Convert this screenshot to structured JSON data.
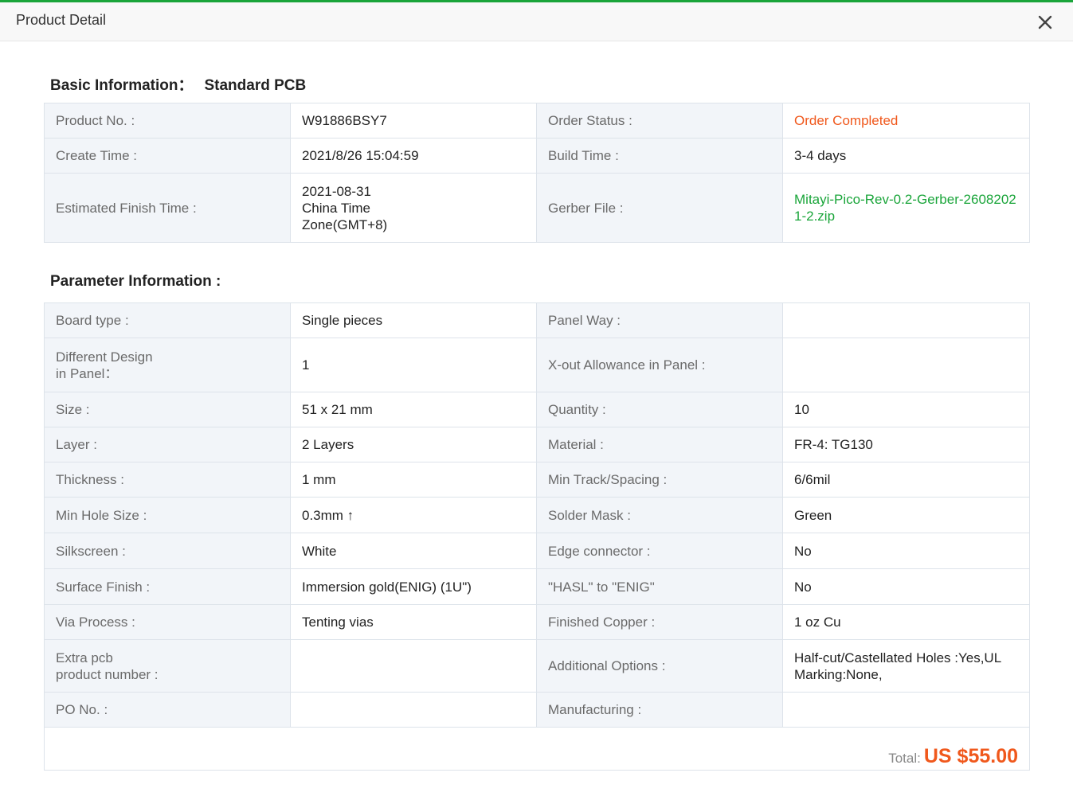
{
  "window": {
    "title": "Product Detail"
  },
  "basic": {
    "heading": "Basic Information：",
    "product_type": "Standard PCB",
    "rows": [
      [
        {
          "label": "Product No. :",
          "value": "W91886BSY7"
        },
        {
          "label": "Order Status :",
          "value": "Order Completed"
        }
      ],
      [
        {
          "label": "Create Time :",
          "value": "2021/8/26 15:04:59"
        },
        {
          "label": "Build Time :",
          "value": "3-4 days"
        }
      ],
      [
        {
          "label": "Estimated Finish Time :",
          "value": "2021-08-31\nChina Time\nZone(GMT+8)"
        },
        {
          "label": "Gerber File :",
          "value": "Mitayi-Pico-Rev-0.2-Gerber-26082021-2.zip"
        }
      ]
    ]
  },
  "params": {
    "heading": "Parameter Information :",
    "rows": [
      [
        {
          "label": "Board type :",
          "value": "Single pieces"
        },
        {
          "label": "Panel Way :",
          "value": ""
        }
      ],
      [
        {
          "label": "Different Design\nin Panel：",
          "value": "1"
        },
        {
          "label": "X-out Allowance in Panel :",
          "value": ""
        }
      ],
      [
        {
          "label": "Size :",
          "value": "51 x 21 mm"
        },
        {
          "label": "Quantity :",
          "value": "10"
        }
      ],
      [
        {
          "label": "Layer :",
          "value": "2 Layers"
        },
        {
          "label": "Material :",
          "value": "FR-4: TG130"
        }
      ],
      [
        {
          "label": "Thickness :",
          "value": "1 mm"
        },
        {
          "label": "Min Track/Spacing :",
          "value": "6/6mil"
        }
      ],
      [
        {
          "label": "Min Hole Size :",
          "value": "0.3mm ↑"
        },
        {
          "label": "Solder Mask :",
          "value": "Green"
        }
      ],
      [
        {
          "label": "Silkscreen :",
          "value": "White"
        },
        {
          "label": "Edge connector :",
          "value": "No"
        }
      ],
      [
        {
          "label": "Surface Finish :",
          "value": "Immersion gold(ENIG) (1U\")"
        },
        {
          "label": "\"HASL\" to \"ENIG\"",
          "value": "No"
        }
      ],
      [
        {
          "label": "Via Process :",
          "value": "Tenting vias"
        },
        {
          "label": "Finished Copper :",
          "value": "1 oz Cu"
        }
      ],
      [
        {
          "label": "Extra pcb\nproduct number :",
          "value": ""
        },
        {
          "label": "Additional Options :",
          "value": "Half-cut/Castellated Holes :Yes,UL\nMarking:None,"
        }
      ],
      [
        {
          "label": "PO No. :",
          "value": ""
        },
        {
          "label": "Manufacturing :",
          "value": ""
        }
      ]
    ],
    "total_label": "Total:",
    "total_value": "US $55.00"
  },
  "colors": {
    "accent": "#1aa53a",
    "status": "#f0581c",
    "label_bg": "#f2f5f9"
  },
  "icons": {
    "close": "close-icon"
  }
}
